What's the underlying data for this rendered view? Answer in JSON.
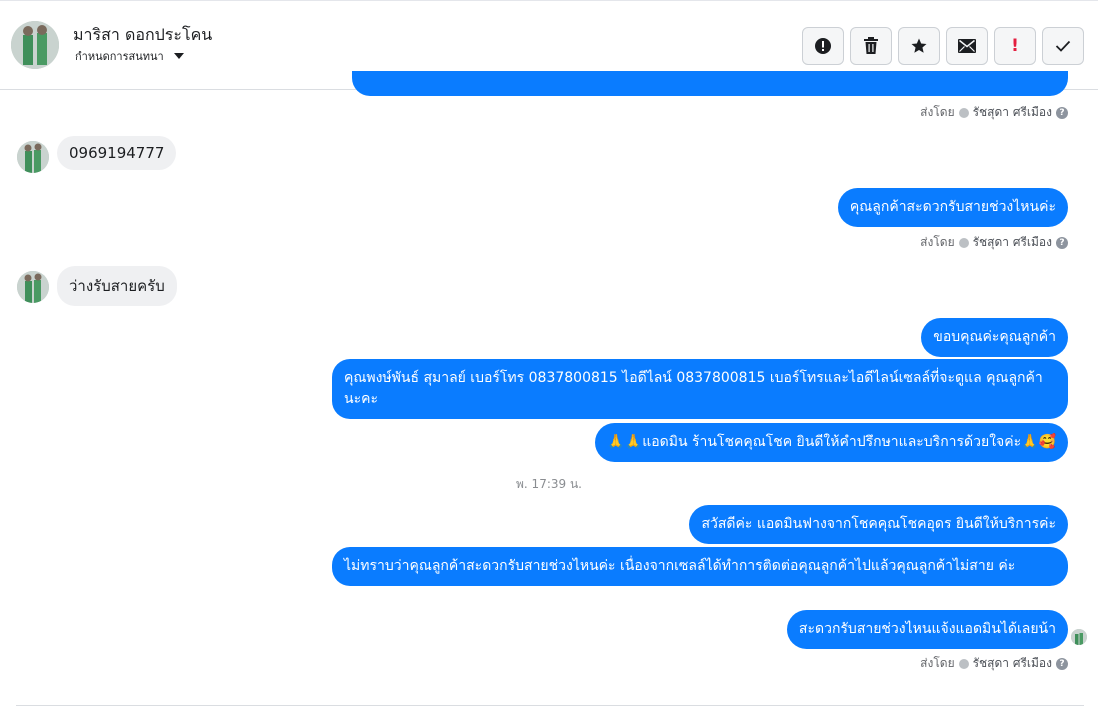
{
  "header": {
    "contact_name": "มาริสา ดอกประโคน",
    "subtitle": "กำหนดการสนทนา",
    "actions": [
      {
        "name": "report-button",
        "icon": "alert-circle-icon"
      },
      {
        "name": "delete-button",
        "icon": "trash-icon"
      },
      {
        "name": "star-button",
        "icon": "star-icon"
      },
      {
        "name": "mail-button",
        "icon": "envelope-icon"
      },
      {
        "name": "important-button",
        "icon": "exclamation-icon",
        "label": "!"
      },
      {
        "name": "done-button",
        "icon": "checkmark-icon"
      }
    ]
  },
  "messages": {
    "meta_prefix": "ส่งโดย",
    "sender": "รัชสุดา ศรีเมือง",
    "help": "?",
    "in_1": "0969194777",
    "out_1": "คุณลูกค้าสะดวกรับสายช่วงไหนค่ะ",
    "in_2": "ว่างรับสายครับ",
    "out_2": "ขอบคุณค่ะคุณลูกค้า",
    "out_3": "คุณพงษ์พันธ์ สุมาลย์     เบอร์โทร 0837800815  ไอดีไลน์ 0837800815   เบอร์โทรและไอดีไลน์เซลล์ที่จะดูแล คุณลูกค้านะคะ",
    "out_4": "🙏🙏แอดมิน ร้านโชคคุณโชค ยินดีให้คำปรึกษาและบริการด้วยใจค่ะ🙏🥰",
    "timestamp": "พ. 17:39 น.",
    "out_5": "สวัสดีค่ะ แอดมินฟางจากโชคคุณโชคอุดร ยินดีให้บริการค่ะ",
    "out_6": "ไม่ทราบว่าคุณลูกค้าสะดวกรับสายช่วงไหนค่ะ  เนื่องจากเซลล์ได้ทำการติดต่อคุณลูกค้าไปแล้วคุณลูกค้าไม่สาย ค่ะ",
    "out_7": "สะดวกรับสายช่วงไหนแจ้งแอดมินได้เลยน้า"
  },
  "colors": {
    "outgoing_bubble": "#0a7cff",
    "incoming_bubble": "#eff0f2",
    "important": "#e41e3f"
  }
}
